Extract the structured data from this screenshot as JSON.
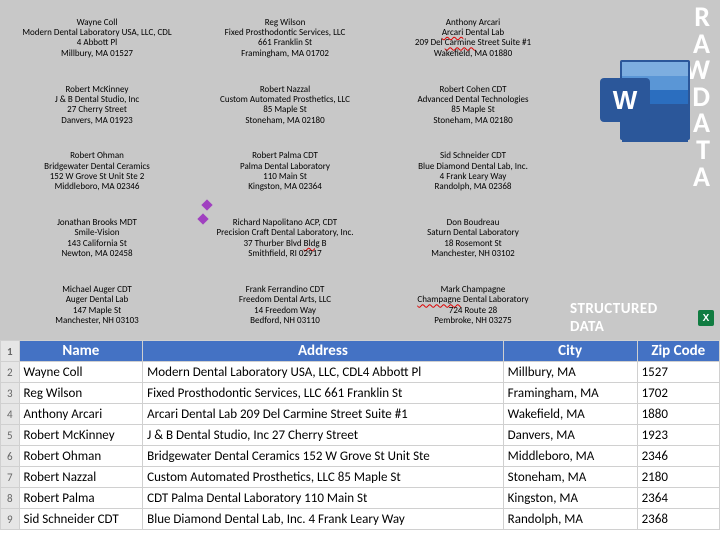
{
  "side": {
    "raw_label": "RAWDATA",
    "structured_label": "STRUCTURED DATA",
    "word_icon_letter": "W",
    "excel_icon_letter": "X"
  },
  "raw_entries": [
    {
      "name": "Wayne Coll",
      "company": "Modern Dental Laboratory USA, LLC, CDL",
      "street": "4 Abbott Pl",
      "citystate": "Millbury, MA  01527"
    },
    {
      "name": "Reg Wilson",
      "company": "Fixed Prosthodontic Services, LLC",
      "street": "661 Franklin St",
      "citystate": "Framingham, MA  01702"
    },
    {
      "name": "Anthony Arcari",
      "company": "Arcari Dental Lab",
      "company_flag_word": "Arcari",
      "street": "209 Del Carmine Street Suite #1",
      "street_flag_word": "Carmine",
      "citystate": "Wakefield, MA  01880"
    },
    {
      "name": "Robert McKinney",
      "company": "J & B Dental Studio, Inc",
      "street": "27 Cherry Street",
      "citystate": "Danvers, MA  01923"
    },
    {
      "name": "Robert Nazzal",
      "company": "Custom Automated Prosthetics, LLC",
      "street": "85 Maple St",
      "citystate": "Stoneham, MA  02180"
    },
    {
      "name": "Robert Cohen CDT",
      "company": "Advanced Dental Technologies",
      "street": "85 Maple St",
      "citystate": "Stoneham, MA  02180"
    },
    {
      "name": "Robert Ohman",
      "company": "Bridgewater Dental Ceramics",
      "street": "152 W Grove St Unit Ste 2",
      "citystate": "Middleboro, MA  02346"
    },
    {
      "name": "Robert Palma CDT",
      "company": "Palma Dental Laboratory",
      "street": "110 Main St",
      "citystate": "Kingston, MA  02364"
    },
    {
      "name": "Sid Schneider CDT",
      "company": "Blue Diamond Dental Lab, Inc.",
      "street": "4 Frank Leary Way",
      "citystate": "Randolph, MA  02368"
    },
    {
      "name": "Jonathan Brooks MDT",
      "company": "Smile-Vision",
      "street": "143 California St",
      "citystate": "Newton, MA  02458"
    },
    {
      "name": "Richard Napolitano ACP, CDT",
      "company": "Precision Craft Dental Laboratory, Inc.",
      "street": "37 Thurber Blvd Bldg B",
      "street_flag_word": "Bldg",
      "citystate": "Smithfield, RI  02917"
    },
    {
      "name": "Don Boudreau",
      "company": "Saturn Dental Laboratory",
      "street": "18 Rosemont St",
      "citystate": "Manchester, NH  03102"
    },
    {
      "name": "Michael Auger CDT",
      "company": "Auger Dental Lab",
      "street": "147 Maple St",
      "citystate": "Manchester, NH  03103"
    },
    {
      "name": "Frank Ferrandino CDT",
      "company": "Freedom Dental Arts, LLC",
      "street": "14 Freedom Way",
      "citystate": "Bedford, NH  03110"
    },
    {
      "name": "Mark Champagne",
      "company": "Champagne Dental Laboratory",
      "company_flag_word": "Champagne",
      "street": "724 Route 28",
      "citystate": "Pembroke, NH  03275"
    }
  ],
  "table": {
    "headers": {
      "name": "Name",
      "address": "Address",
      "city": "City",
      "zip": "Zip Code"
    },
    "rows": [
      {
        "n": "2",
        "name": "Wayne Coll",
        "address": "Modern Dental Laboratory USA, LLC, CDL4 Abbott Pl",
        "city": "Millbury, MA",
        "zip": "1527"
      },
      {
        "n": "3",
        "name": "Reg Wilson",
        "address": "Fixed Prosthodontic Services, LLC 661 Franklin St",
        "city": "Framingham, MA",
        "zip": "1702"
      },
      {
        "n": "4",
        "name": "Anthony Arcari",
        "address": "Arcari Dental Lab 209 Del Carmine Street Suite #1",
        "city": "Wakefield, MA",
        "zip": "1880"
      },
      {
        "n": "5",
        "name": "Robert McKinney",
        "address": "J & B Dental Studio, Inc 27 Cherry Street",
        "city": "Danvers, MA",
        "zip": "1923"
      },
      {
        "n": "6",
        "name": "Robert Ohman",
        "address": "Bridgewater Dental Ceramics 152 W Grove St Unit Ste",
        "city": "Middleboro, MA",
        "zip": "2346"
      },
      {
        "n": "7",
        "name": "Robert Nazzal",
        "address": "Custom Automated Prosthetics, LLC 85 Maple St",
        "city": "Stoneham, MA",
        "zip": "2180"
      },
      {
        "n": "8",
        "name": "Robert Palma",
        "address": "CDT Palma Dental Laboratory 110 Main St",
        "city": "Kingston, MA",
        "zip": "2364"
      },
      {
        "n": "9",
        "name": "Sid Schneider CDT",
        "address": "Blue Diamond Dental Lab, Inc. 4 Frank Leary Way",
        "city": "Randolph, MA",
        "zip": "2368"
      }
    ]
  },
  "chart_data": {
    "type": "table",
    "title": "Structured Data",
    "columns": [
      "Name",
      "Address",
      "City",
      "Zip Code"
    ],
    "rows": [
      [
        "Wayne Coll",
        "Modern Dental Laboratory USA, LLC, CDL4 Abbott Pl",
        "Millbury, MA",
        1527
      ],
      [
        "Reg Wilson",
        "Fixed Prosthodontic Services, LLC 661 Franklin St",
        "Framingham, MA",
        1702
      ],
      [
        "Anthony Arcari",
        "Arcari Dental Lab 209 Del Carmine Street Suite #1",
        "Wakefield, MA",
        1880
      ],
      [
        "Robert McKinney",
        "J & B Dental Studio, Inc 27 Cherry Street",
        "Danvers, MA",
        1923
      ],
      [
        "Robert Ohman",
        "Bridgewater Dental Ceramics 152 W Grove St Unit Ste",
        "Middleboro, MA",
        2346
      ],
      [
        "Robert Nazzal",
        "Custom Automated Prosthetics, LLC 85 Maple St",
        "Stoneham, MA",
        2180
      ],
      [
        "Robert Palma",
        "CDT Palma Dental Laboratory 110 Main St",
        "Kingston, MA",
        2364
      ],
      [
        "Sid Schneider CDT",
        "Blue Diamond Dental Lab, Inc. 4 Frank Leary Way",
        "Randolph, MA",
        2368
      ]
    ]
  }
}
